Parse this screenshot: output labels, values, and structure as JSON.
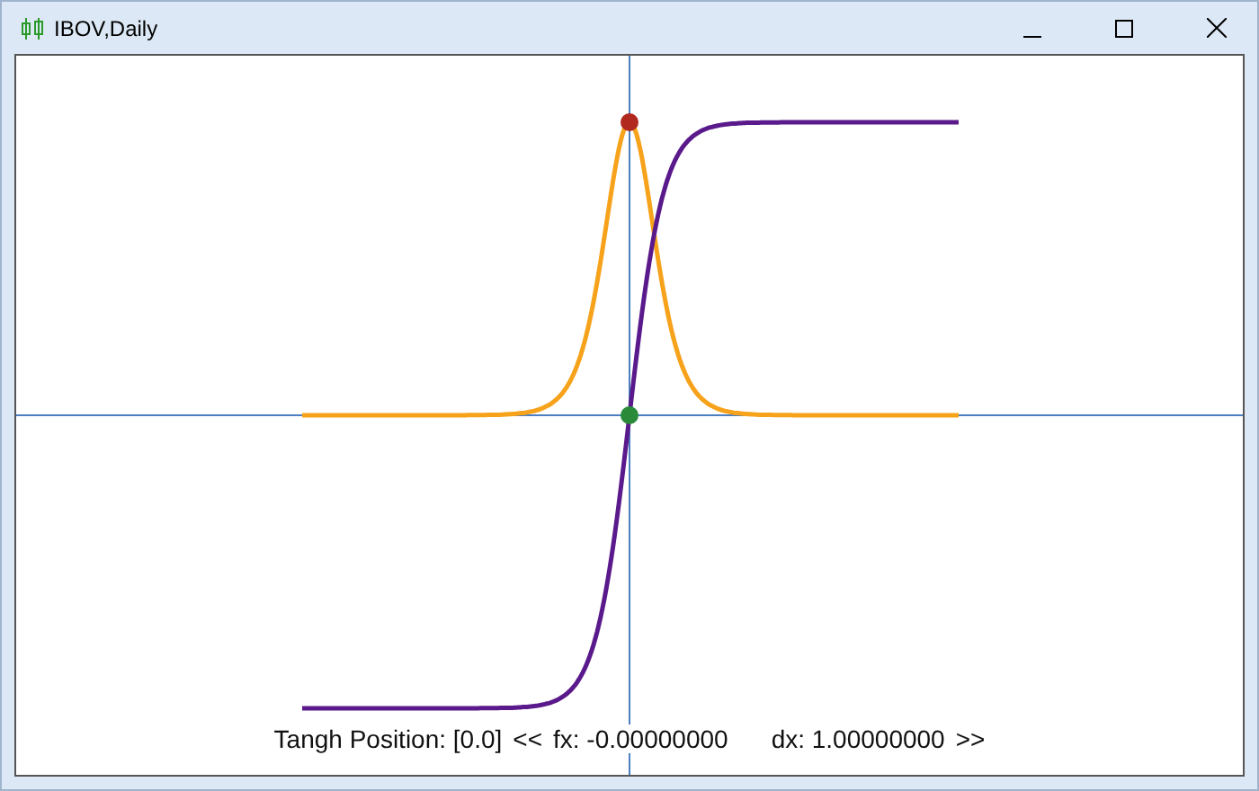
{
  "window": {
    "title": "IBOV,Daily"
  },
  "status": {
    "position": "Tangh Position: [0.0]",
    "prev": "<<",
    "fx": "fx: -0.00000000",
    "dx": "dx: 1.00000000",
    "next": ">>"
  }
}
